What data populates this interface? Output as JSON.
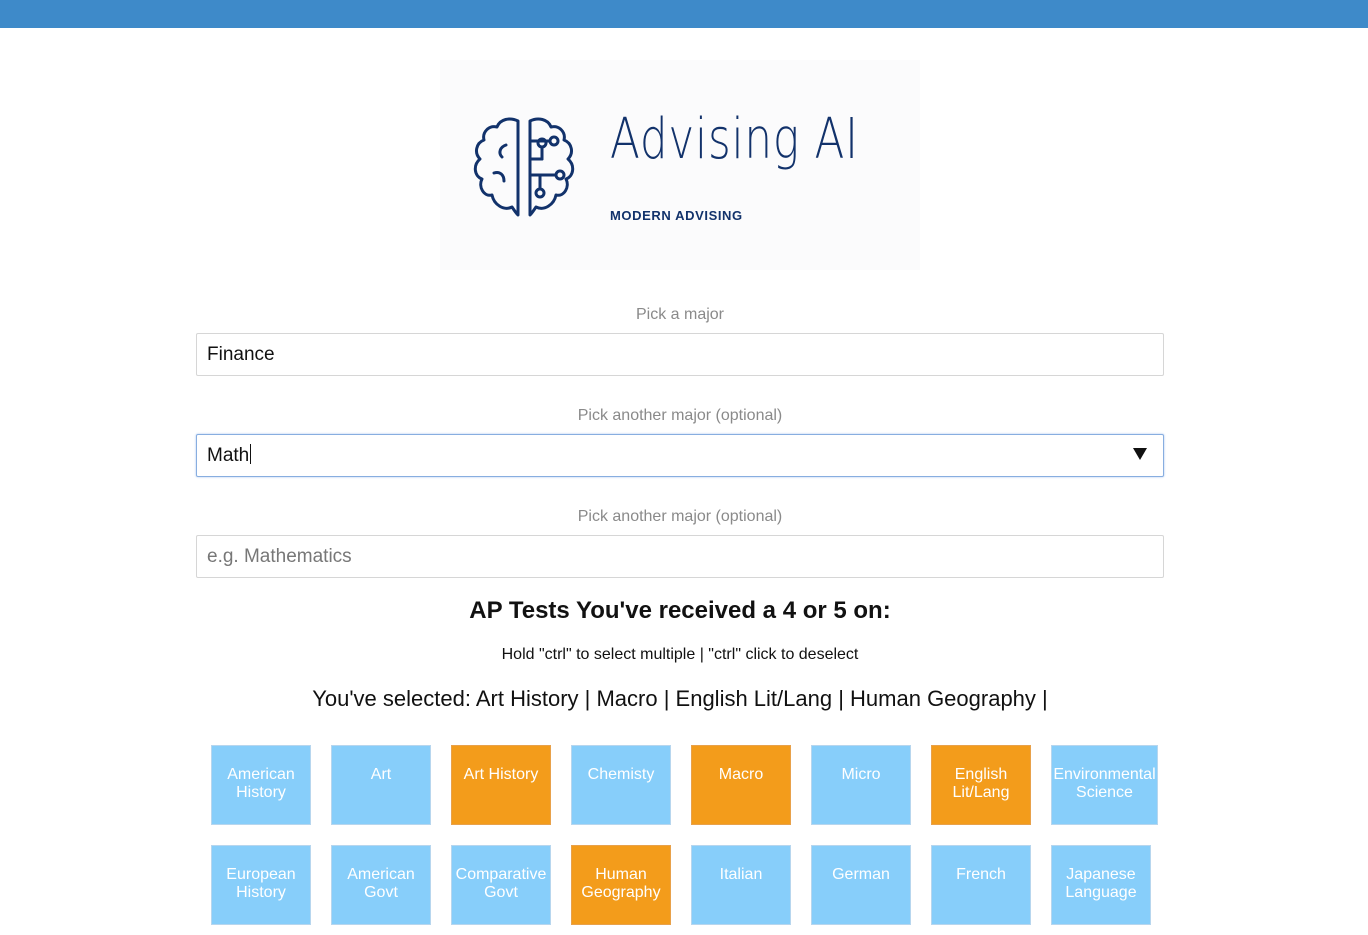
{
  "logo": {
    "title": "Advising AI",
    "subtitle": "MODERN ADVISING",
    "icon": "brain-circuit-icon",
    "color": "#12326b"
  },
  "fields": [
    {
      "label": "Pick a major",
      "value": "Finance",
      "placeholder": ""
    },
    {
      "label": "Pick another major (optional)",
      "value": "Math",
      "placeholder": ""
    },
    {
      "label": "Pick another major (optional)",
      "value": "",
      "placeholder": "e.g. Mathematics"
    }
  ],
  "ap": {
    "heading": "AP Tests You've received a 4 or 5 on:",
    "hint": "Hold \"ctrl\" to select multiple | \"ctrl\" click to deselect",
    "selected_text": "You've selected: Art History | Macro | English Lit/Lang | Human Geography |",
    "tiles": [
      {
        "label": "American History",
        "selected": false
      },
      {
        "label": "Art",
        "selected": false
      },
      {
        "label": "Art History",
        "selected": true
      },
      {
        "label": "Chemisty",
        "selected": false
      },
      {
        "label": "Macro",
        "selected": true
      },
      {
        "label": "Micro",
        "selected": false
      },
      {
        "label": "English Lit/Lang",
        "selected": true
      },
      {
        "label": "Environmental Science",
        "selected": false
      },
      {
        "label": "European History",
        "selected": false
      },
      {
        "label": "American Govt",
        "selected": false
      },
      {
        "label": "Comparative Govt",
        "selected": false
      },
      {
        "label": "Human Geography",
        "selected": true
      },
      {
        "label": "Italian",
        "selected": false
      },
      {
        "label": "German",
        "selected": false
      },
      {
        "label": "French",
        "selected": false
      },
      {
        "label": "Japanese Language",
        "selected": false
      }
    ]
  },
  "colors": {
    "topbar": "#3e8ac9",
    "tile_default": "#87cefa",
    "tile_selected": "#f39c1b"
  }
}
